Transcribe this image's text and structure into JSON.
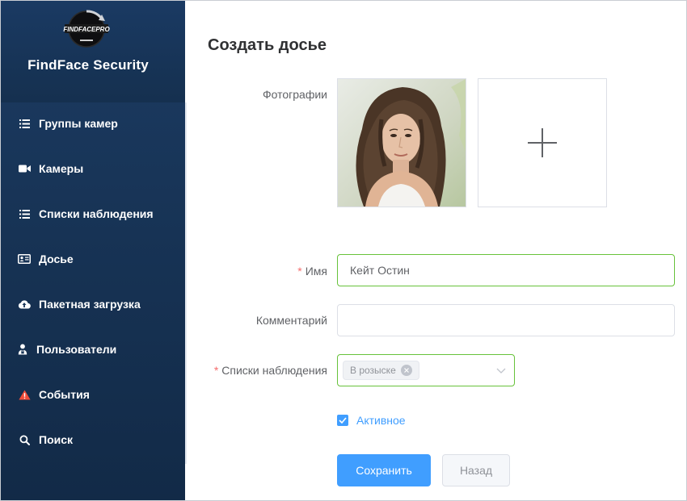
{
  "sidebar": {
    "logo_text": "FINDFACEPRO",
    "brand_title": "FindFace Security",
    "items": [
      {
        "label": "Группы камер",
        "icon": "list-icon"
      },
      {
        "label": "Камеры",
        "icon": "video-camera-icon"
      },
      {
        "label": "Списки наблюдения",
        "icon": "list-icon"
      },
      {
        "label": "Досье",
        "icon": "id-card-icon"
      },
      {
        "label": "Пакетная загрузка",
        "icon": "cloud-upload-icon"
      },
      {
        "label": "Пользователи",
        "icon": "user-lock-icon"
      },
      {
        "label": "События",
        "icon": "warning-icon"
      },
      {
        "label": "Поиск",
        "icon": "search-icon"
      }
    ]
  },
  "form": {
    "title": "Создать досье",
    "photos_label": "Фотографии",
    "name_label": "Имя",
    "name_value": "Кейт Остин",
    "comment_label": "Комментарий",
    "comment_value": "",
    "watchlists_label": "Списки наблюдения",
    "watchlist_tag": "В розыске",
    "active_label": "Активное",
    "active_checked": true,
    "save_label": "Сохранить",
    "back_label": "Назад"
  },
  "colors": {
    "sidebar_bg": "#183558",
    "primary": "#409eff",
    "success_border": "#67c23a",
    "required": "#f56c6c",
    "warning_icon": "#f04d3a"
  }
}
